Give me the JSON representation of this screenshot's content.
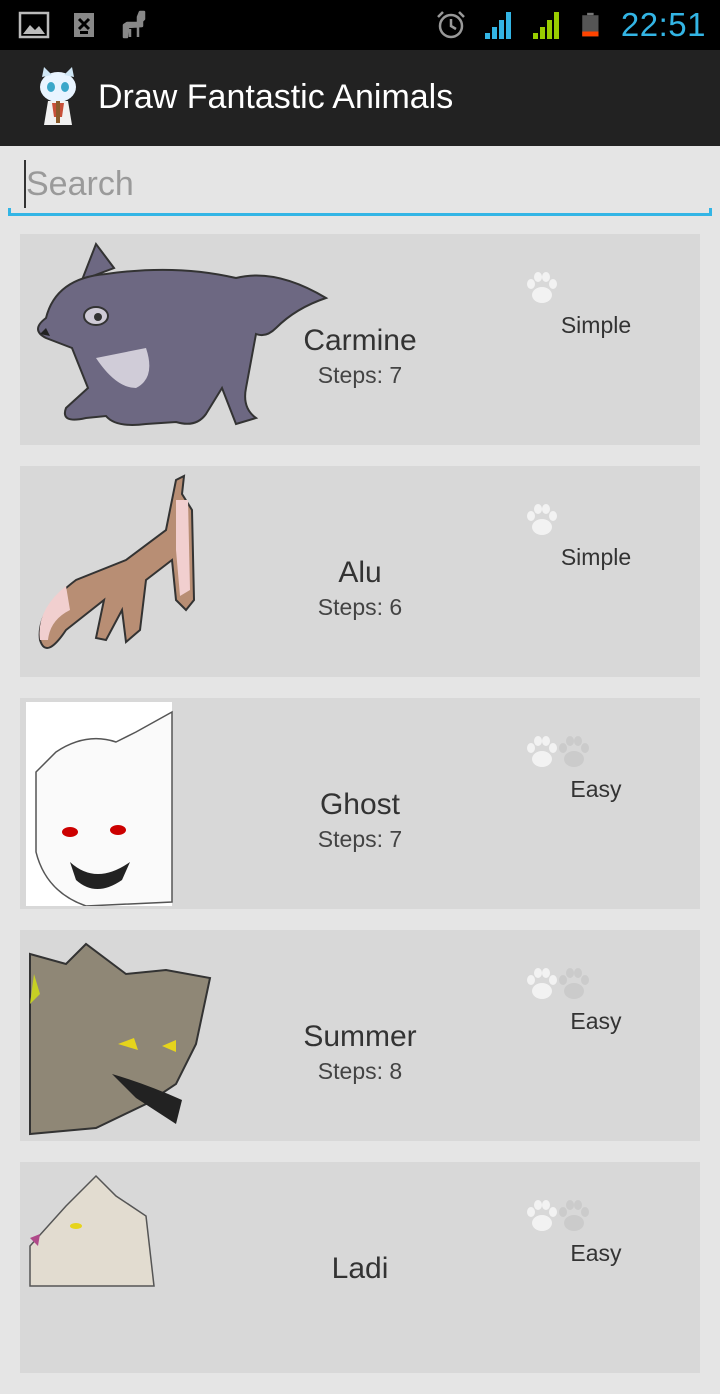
{
  "status_bar": {
    "time": "22:51",
    "left_icons": [
      "image-icon",
      "usb-debug-icon",
      "alpaca-icon"
    ],
    "right_icons": [
      "alarm-icon",
      "wifi-signal-icon",
      "cell-signal-icon",
      "battery-icon"
    ],
    "colors": {
      "accent": "#33b5e5",
      "signal_green": "#99cc00",
      "battery_low": "#ff4400"
    }
  },
  "app_bar": {
    "title": "Draw Fantastic Animals",
    "icon": "app-wolf-icon"
  },
  "search": {
    "placeholder": "Search",
    "value": ""
  },
  "animals": [
    {
      "name": "Carmine",
      "steps": "Steps: 7",
      "difficulty": "Simple",
      "paws_filled": 1,
      "paws_total": 1,
      "image": "carmine-wolf-illustration"
    },
    {
      "name": "Alu",
      "steps": "Steps: 6",
      "difficulty": "Simple",
      "paws_filled": 1,
      "paws_total": 1,
      "image": "alu-wolf-illustration"
    },
    {
      "name": "Ghost",
      "steps": "Steps: 7",
      "difficulty": "Easy",
      "paws_filled": 1,
      "paws_total": 2,
      "image": "ghost-wolf-illustration"
    },
    {
      "name": "Summer",
      "steps": "Steps: 8",
      "difficulty": "Easy",
      "paws_filled": 1,
      "paws_total": 2,
      "image": "summer-wolf-illustration"
    },
    {
      "name": "Ladi",
      "steps": "",
      "difficulty": "Easy",
      "paws_filled": 1,
      "paws_total": 2,
      "image": "ladi-wolf-illustration"
    }
  ]
}
